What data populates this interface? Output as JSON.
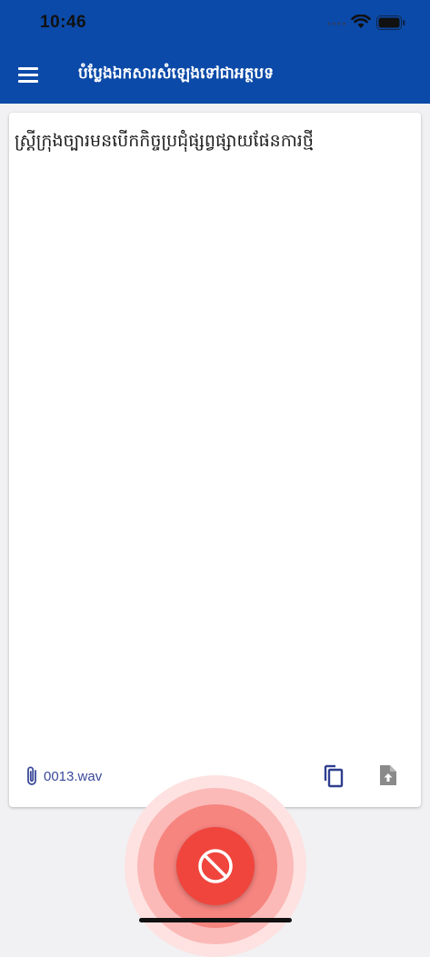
{
  "status": {
    "time": "10:46"
  },
  "appbar": {
    "title": "បំប្លែងឯកសារសំឡេងទៅជាអត្ថបទ"
  },
  "transcript": {
    "text": "ស្ត្រីក្រុងច្បារមនបើកកិច្ចប្រជុំផ្សព្វផ្សាយផែនការថ្មី"
  },
  "file": {
    "name": "0013.wav"
  },
  "colors": {
    "primary": "#0b4aa8",
    "record": "#f0453d",
    "accent_text": "#3b4a9a"
  },
  "icons": {
    "menu": "hamburger-icon",
    "attachment": "paperclip-icon",
    "copy": "copy-icon",
    "export": "file-upload-icon",
    "stop": "block-icon"
  }
}
